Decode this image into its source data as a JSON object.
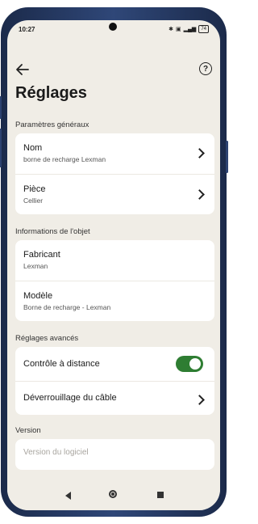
{
  "status_bar": {
    "time": "10:27",
    "battery": "74"
  },
  "header": {
    "back_icon": "arrow-left-icon",
    "help_label": "?",
    "title": "Réglages"
  },
  "sections": {
    "general": {
      "title": "Paramètres généraux",
      "items": [
        {
          "label": "Nom",
          "value": "borne de recharge Lexman"
        },
        {
          "label": "Pièce",
          "value": "Cellier"
        }
      ]
    },
    "object_info": {
      "title": "Informations de l'objet",
      "items": [
        {
          "label": "Fabricant",
          "value": "Lexman"
        },
        {
          "label": "Modèle",
          "value": "Borne de recharge - Lexman"
        }
      ]
    },
    "advanced": {
      "title": "Réglages avancés",
      "remote_control": {
        "label": "Contrôle à distance",
        "enabled": true
      },
      "cable_unlock": {
        "label": "Déverrouillage du câble"
      }
    },
    "version": {
      "title": "Version",
      "placeholder": "Version du logiciel"
    }
  },
  "colors": {
    "background": "#f0ede6",
    "toggle_on": "#2e7d32",
    "frame": "#2f4778"
  }
}
